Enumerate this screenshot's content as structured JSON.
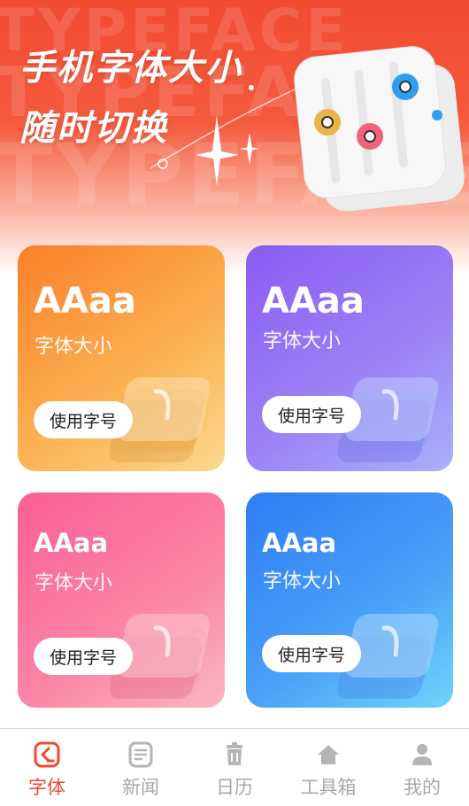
{
  "hero": {
    "watermark": "TYPEFACE",
    "title_line1": "手机字体大小",
    "title_line2": "随时切换"
  },
  "cards": [
    {
      "sample": "AAaa",
      "label": "字体大小",
      "button": "使用字号"
    },
    {
      "sample": "AAaa",
      "label": "字体大小",
      "button": "使用字号"
    },
    {
      "sample": "AAaa",
      "label": "字体大小",
      "button": "使用字号"
    },
    {
      "sample": "AAaa",
      "label": "字体大小",
      "button": "使用字号"
    }
  ],
  "tabbar": {
    "active_color": "#f04a2f",
    "inactive_color": "#a8a8a8",
    "items": [
      {
        "label": "字体",
        "icon": "font-icon",
        "active": true
      },
      {
        "label": "新闻",
        "icon": "news-icon",
        "active": false
      },
      {
        "label": "日历",
        "icon": "calendar-icon",
        "active": false
      },
      {
        "label": "工具箱",
        "icon": "home-icon",
        "active": false
      },
      {
        "label": "我的",
        "icon": "user-icon",
        "active": false
      }
    ]
  }
}
